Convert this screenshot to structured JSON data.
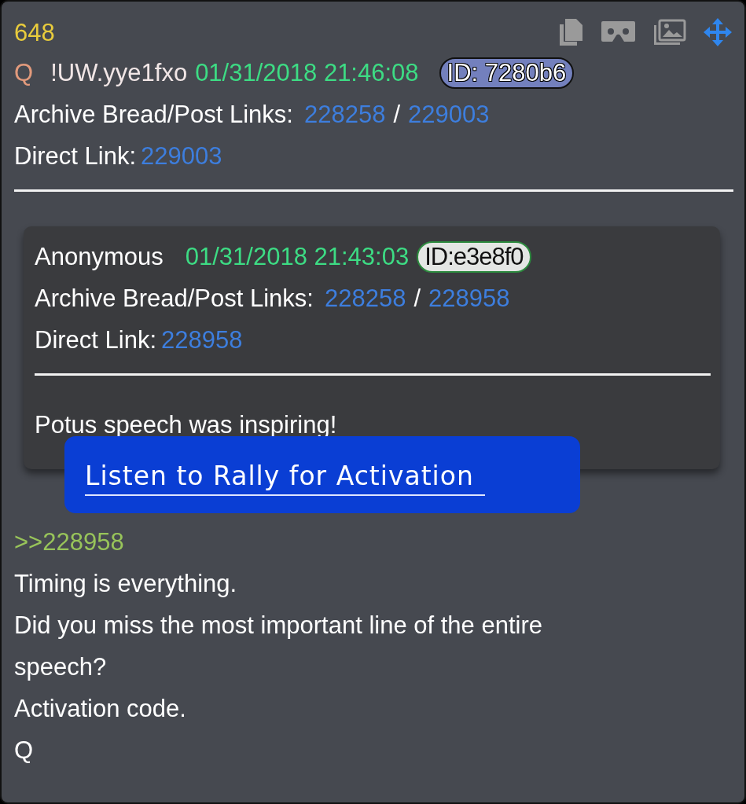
{
  "post": {
    "number": "648",
    "author": "Q",
    "tripcode": "!UW.yye1fxo",
    "datetime": "01/31/2018 21:46:08",
    "id_badge": "ID: 7280b6",
    "archive_label": "Archive Bread/Post Links:",
    "archive_links": [
      "228258",
      "229003"
    ],
    "separator": "/",
    "direct_label": "Direct Link:",
    "direct_link": "229003"
  },
  "quote": {
    "author": "Anonymous",
    "datetime": "01/31/2018 21:43:03",
    "id_badge": "ID:e3e8f0",
    "archive_label": "Archive Bread/Post Links:",
    "archive_links": [
      "228258",
      "228958"
    ],
    "separator": "/",
    "direct_label": "Direct Link:",
    "direct_link": "228958",
    "text": "Potus speech was inspiring!"
  },
  "audio_link": "Listen to Rally for Activation",
  "body": [
    {
      "kind": "reply",
      "text": ">>228958"
    },
    {
      "kind": "text",
      "text": "Timing is everything."
    },
    {
      "kind": "text",
      "text": "Did you miss the most important line of the entire speech?"
    },
    {
      "kind": "text",
      "text": "Activation code."
    },
    {
      "kind": "text",
      "text": "Q"
    }
  ]
}
